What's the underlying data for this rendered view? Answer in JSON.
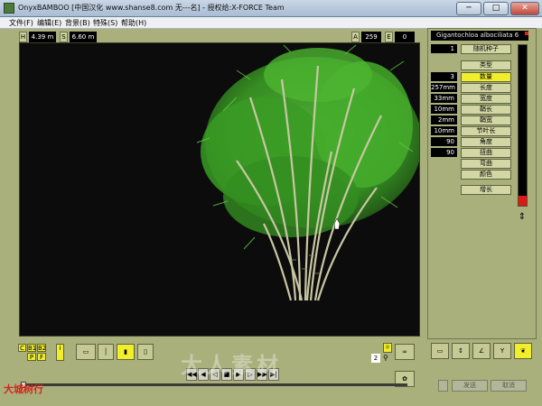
{
  "window": {
    "title": "OnyxBAMBOO [中国汉化 www.shanse8.com 无---名] - 授权给:X-FORCE Team",
    "close_label": "✕",
    "minimize_label": "─",
    "maximize_label": "□"
  },
  "menu": [
    {
      "label": "文件(F)"
    },
    {
      "label": "编辑(E)"
    },
    {
      "label": "背景(B)"
    },
    {
      "label": "特殊(S)"
    },
    {
      "label": "帮助(H)"
    }
  ],
  "top_strip": {
    "h_label": "H",
    "h_value": "4.39 m",
    "s_label": "S",
    "s_value": "6.60 m",
    "a_label": "A",
    "a_value": "259",
    "e_label": "E",
    "e_value": "0"
  },
  "panel": {
    "species": "Gigantochloa albociliata 6",
    "seed_value": "1",
    "seed_button": "随机种子",
    "type_button": "类型",
    "rows": [
      {
        "value": "3",
        "label": "数量",
        "selected": true
      },
      {
        "value": "257mm",
        "label": "长度",
        "selected": false
      },
      {
        "value": "33mm",
        "label": "宽度",
        "selected": false
      },
      {
        "value": "10mm",
        "label": "鞘长",
        "selected": false
      },
      {
        "value": "2mm",
        "label": "鞘宽",
        "selected": false
      },
      {
        "value": "10mm",
        "label": "节叶长",
        "selected": false
      },
      {
        "value": "90",
        "label": "角度",
        "selected": false
      },
      {
        "value": "90",
        "label": "扭曲",
        "selected": false
      },
      {
        "value": "",
        "label": "弯曲",
        "selected": false
      },
      {
        "value": "",
        "label": "颜色",
        "selected": false
      }
    ],
    "grow_button": "增长",
    "meter_level": 0.06
  },
  "bottom": {
    "mode_buttons": [
      "C",
      "B1",
      "B2",
      "P",
      "F"
    ],
    "counter_value": "2",
    "send_button": "发送",
    "cancel_button": "取消"
  },
  "watermark": {
    "text": "大人素材"
  },
  "logo": {
    "text": "大城树行"
  },
  "colors": {
    "accent_yellow": "#f2ee2c",
    "panel_olive": "#a9b07c",
    "bamboo_leaf": "#3fa82a",
    "meter_red": "#e01818"
  }
}
